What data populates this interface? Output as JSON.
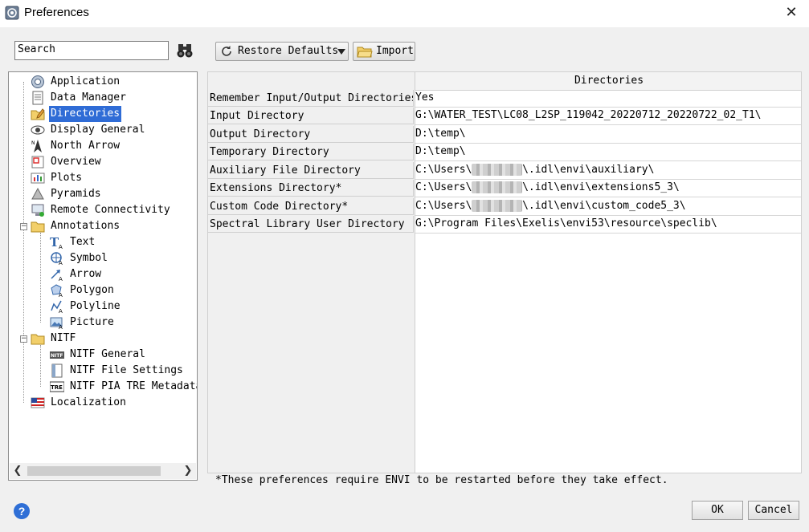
{
  "window": {
    "title": "Preferences",
    "close_glyph": "✕"
  },
  "search": {
    "value": "Search"
  },
  "toolbar": {
    "restore_label": "Restore Defaults",
    "import_label": "Import"
  },
  "tree": {
    "items": [
      {
        "label": "Application",
        "icon": "application-icon"
      },
      {
        "label": "Data Manager",
        "icon": "data-manager-icon"
      },
      {
        "label": "Directories",
        "icon": "directories-icon",
        "selected": true
      },
      {
        "label": "Display General",
        "icon": "display-icon"
      },
      {
        "label": "North Arrow",
        "icon": "north-arrow-icon"
      },
      {
        "label": "Overview",
        "icon": "overview-icon"
      },
      {
        "label": "Plots",
        "icon": "plots-icon"
      },
      {
        "label": "Pyramids",
        "icon": "pyramid-icon"
      },
      {
        "label": "Remote Connectivity",
        "icon": "remote-icon"
      },
      {
        "label": "Annotations",
        "icon": "folder-icon",
        "expanded": true
      },
      {
        "label": "Text",
        "icon": "text-annotation-icon"
      },
      {
        "label": "Symbol",
        "icon": "symbol-annotation-icon"
      },
      {
        "label": "Arrow",
        "icon": "arrow-annotation-icon"
      },
      {
        "label": "Polygon",
        "icon": "polygon-annotation-icon"
      },
      {
        "label": "Polyline",
        "icon": "polyline-annotation-icon"
      },
      {
        "label": "Picture",
        "icon": "picture-annotation-icon"
      },
      {
        "label": "NITF",
        "icon": "folder-icon",
        "expanded": true
      },
      {
        "label": "NITF General",
        "icon": "nitf-icon"
      },
      {
        "label": "NITF File Settings",
        "icon": "nitf-file-icon"
      },
      {
        "label": "NITF PIA TRE Metadata",
        "icon": "tre-icon"
      },
      {
        "label": "Localization",
        "icon": "flag-icon"
      }
    ]
  },
  "table": {
    "column_header": "Directories",
    "rows": [
      {
        "name": "Remember Input/Output Directories",
        "value": "Yes"
      },
      {
        "name": "Input Directory",
        "value": "G:\\WATER_TEST\\LC08_L2SP_119042_20220712_20220722_02_T1\\"
      },
      {
        "name": "Output Directory",
        "value": "D:\\temp\\"
      },
      {
        "name": "Temporary Directory",
        "value": "D:\\temp\\"
      },
      {
        "name": "Auxiliary File Directory",
        "value_pre": "C:\\Users\\",
        "value_post": "\\.idl\\envi\\auxiliary\\"
      },
      {
        "name": "Extensions Directory*",
        "value_pre": "C:\\Users\\",
        "value_post": "\\.idl\\envi\\extensions5_3\\"
      },
      {
        "name": "Custom Code Directory*",
        "value_pre": "C:\\Users\\",
        "value_post": "\\.idl\\envi\\custom_code5_3\\"
      },
      {
        "name": "Spectral Library User Directory",
        "value": "G:\\Program Files\\Exelis\\envi53\\resource\\speclib\\"
      }
    ]
  },
  "note": "*These preferences require ENVI to be restarted before they take effect.",
  "buttons": {
    "ok": "OK",
    "cancel": "Cancel",
    "help_glyph": "?"
  },
  "colors": {
    "selection": "#2f6cd6",
    "help": "#2f6fd6"
  }
}
